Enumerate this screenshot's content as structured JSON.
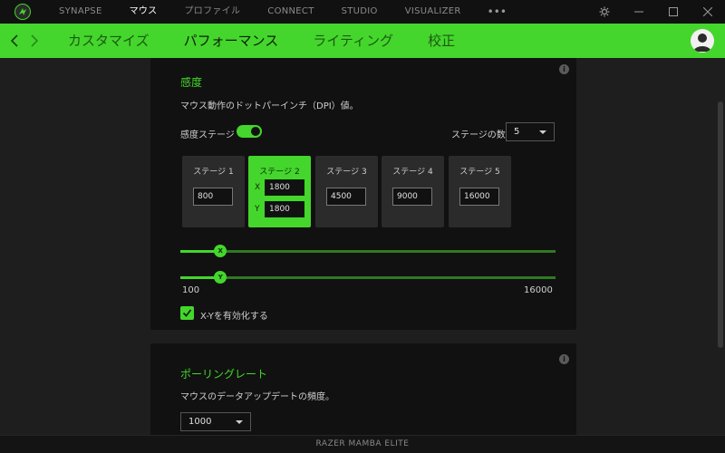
{
  "titlebar": {
    "nav": [
      {
        "label": "SYNAPSE",
        "active": false
      },
      {
        "label": "マウス",
        "active": true
      },
      {
        "label": "プロファイル",
        "active": false
      },
      {
        "label": "CONNECT",
        "active": false
      },
      {
        "label": "STUDIO",
        "active": false
      },
      {
        "label": "VISUALIZER",
        "active": false
      }
    ],
    "more_label": "•••"
  },
  "tabbar": {
    "tabs": [
      {
        "label": "カスタマイズ",
        "active": false
      },
      {
        "label": "パフォーマンス",
        "active": true
      },
      {
        "label": "ライティング",
        "active": false
      },
      {
        "label": "校正",
        "active": false
      }
    ]
  },
  "sensitivity": {
    "title": "感度",
    "description": "マウス動作のドットパーインチ（DPI）値。",
    "stages_label": "感度ステージ",
    "stages_enabled": true,
    "stage_count_label": "ステージの数",
    "stage_count_value": "5",
    "stages": [
      {
        "label": "ステージ 1",
        "value": "800"
      },
      {
        "label": "ステージ 2",
        "x": "1800",
        "y": "1800",
        "x_label": "X",
        "y_label": "Y"
      },
      {
        "label": "ステージ 3",
        "value": "4500"
      },
      {
        "label": "ステージ 4",
        "value": "9000"
      },
      {
        "label": "ステージ 5",
        "value": "16000"
      }
    ],
    "slider_x_label": "X",
    "slider_y_label": "Y",
    "slider_x_value": 1800,
    "slider_y_value": 1800,
    "range_min": "100",
    "range_max": "16000",
    "xy_enable_label": "X-Yを有効化する",
    "xy_enabled": true
  },
  "polling": {
    "title": "ポーリングレート",
    "description": "マウスのデータアップデートの頻度。",
    "value": "1000"
  },
  "footer": {
    "device_name": "RAZER MAMBA ELITE"
  },
  "colors": {
    "accent": "#44d62c",
    "background": "#1e1e1e",
    "card": "#111111"
  }
}
